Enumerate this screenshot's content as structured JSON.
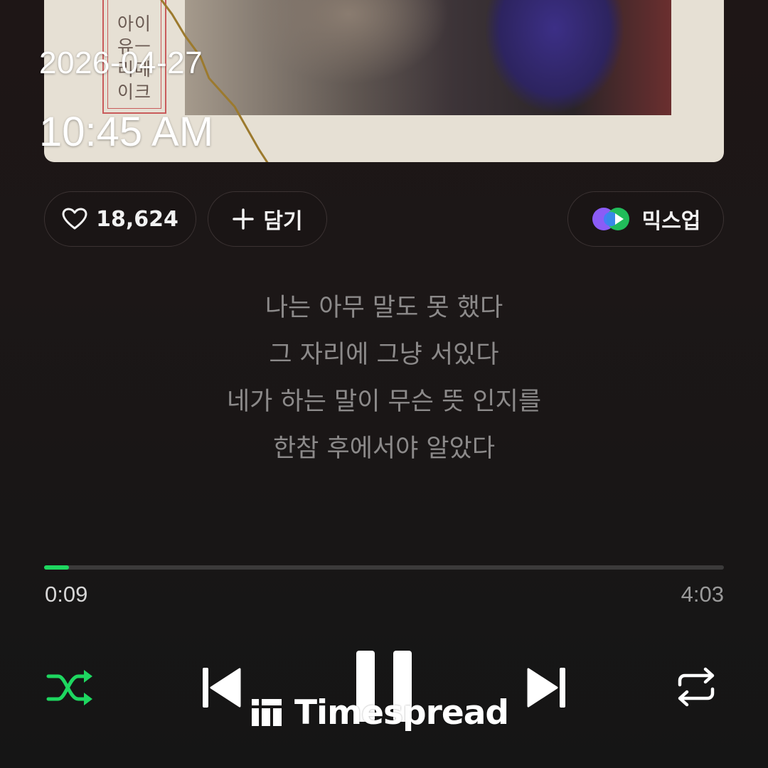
{
  "album_art": {
    "stamp_text": "아이\n유ㅡ\n리메\n이크"
  },
  "overlay": {
    "date": "2026-04-27",
    "time": "10:45 AM"
  },
  "actions": {
    "like_icon": "heart-outline-icon",
    "like_count": "18,624",
    "add_icon": "plus-icon",
    "add_label": "담기",
    "mix_icon": "mixup-logo-icon",
    "mix_label": "믹스업"
  },
  "lyrics": [
    "나는 아무 말도 못 했다",
    "그 자리에 그냥 서있다",
    "네가 하는 말이 무슨 뜻 인지를",
    "한참 후에서야 알았다"
  ],
  "progress": {
    "current": "0:09",
    "total": "4:03",
    "fraction": 0.037
  },
  "controls": {
    "shuffle_icon": "shuffle-icon",
    "prev_icon": "skip-previous-icon",
    "pause_icon": "pause-icon",
    "next_icon": "skip-next-icon",
    "repeat_icon": "repeat-icon"
  },
  "watermark": {
    "text": "Timespread"
  },
  "colors": {
    "accent": "#1ed760",
    "lyric_text": "#8c8a8a",
    "background": "#1a1616"
  }
}
